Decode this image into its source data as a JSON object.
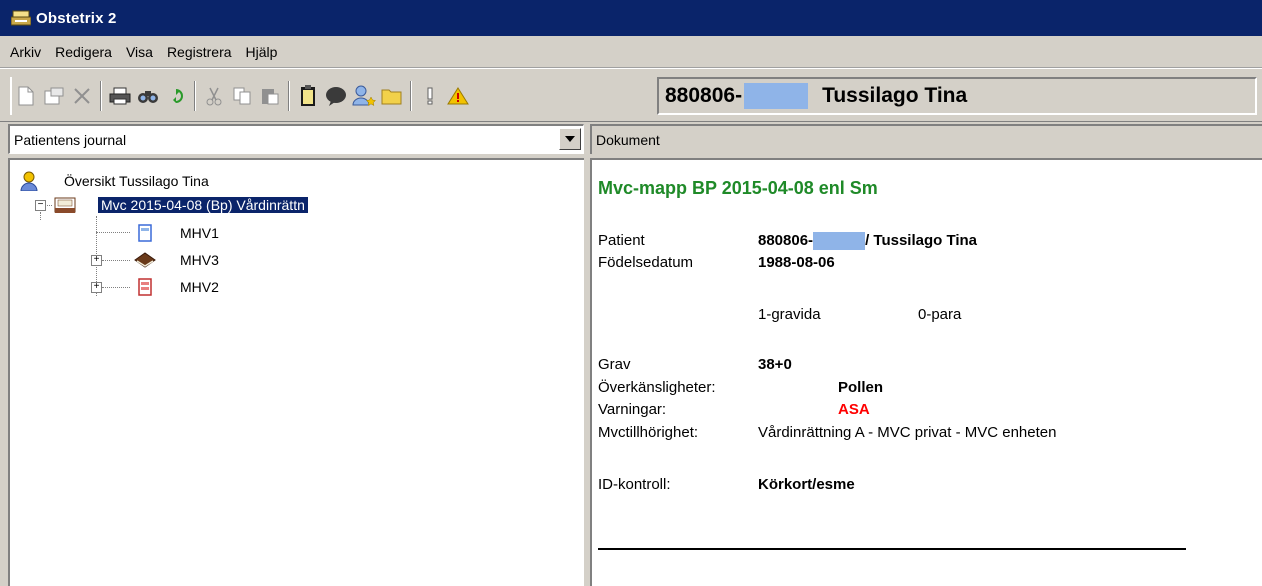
{
  "window": {
    "title": "Obstetrix 2",
    "icon": "app-printer-icon"
  },
  "menu": [
    "Arkiv",
    "Redigera",
    "Visa",
    "Registrera",
    "Hjälp"
  ],
  "toolbar": {
    "icons": [
      "new-document-icon",
      "properties-icon",
      "delete-icon",
      "print-icon",
      "find-icon",
      "refresh-icon",
      "cut-icon",
      "copy-icon",
      "paste-icon",
      "clipboard-icon",
      "speech-bubble-icon",
      "user-star-icon",
      "folder-icon",
      "exclamation-icon",
      "warning-icon"
    ],
    "patient_id": "880806-",
    "patient_name": "Tussilago Tina"
  },
  "left": {
    "combo_value": "Patientens journal",
    "tree": {
      "root_label": "Översikt Tussilago Tina",
      "folder_label": "Mvc 2015-04-08 (Bp)  Vårdinrättn",
      "child1": "MHV1",
      "child2": "MHV3",
      "child3": "MHV2"
    }
  },
  "right": {
    "header": "Dokument",
    "doc": {
      "title": "Mvc-mapp BP 2015-04-08 enl Sm",
      "patient_label": "Patient",
      "patient_id": "880806-",
      "patient_name": "/ Tussilago Tina",
      "birth_label": "Födelsedatum",
      "birth_value": "1988-08-06",
      "gravida": "1-gravida",
      "para": "0-para",
      "grav_label": "Grav",
      "grav_value": "38+0",
      "allergy_label": "Överkänsligheter:",
      "allergy_value": "Pollen",
      "warning_label": "Varningar:",
      "warning_value": "ASA",
      "mvc_label": "Mvctillhörighet:",
      "mvc_value": "Vårdinrättning A - MVC privat - MVC enheten",
      "id_label": "ID-kontroll:",
      "id_value": "Körkort/esme"
    }
  },
  "colors": {
    "title_bar": "#0a246a",
    "doc_title": "#1f8a28",
    "warning": "#ff0000",
    "mask": "#8fb4e8"
  }
}
